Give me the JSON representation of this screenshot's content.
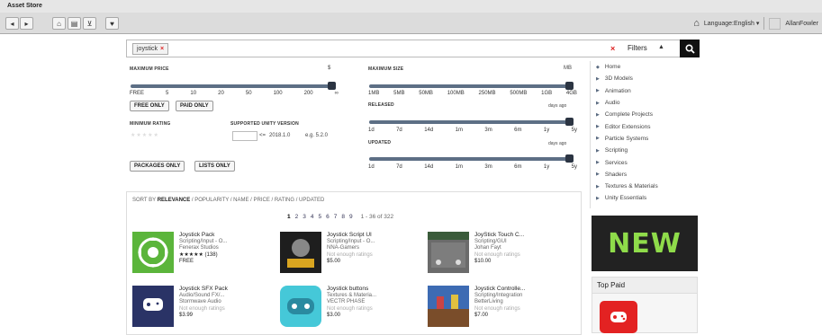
{
  "window": {
    "title": "Asset Store"
  },
  "toolbar": {
    "language_label": "Language:English",
    "user_name": "AllanFowler"
  },
  "search": {
    "tag": "joystick",
    "filters_label": "Filters"
  },
  "filters": {
    "max_price": {
      "label": "MAXIMUM PRICE",
      "unit": "$",
      "ticks": [
        "FREE",
        "5",
        "10",
        "20",
        "50",
        "100",
        "200",
        "∞"
      ]
    },
    "max_size": {
      "label": "MAXIMUM SIZE",
      "unit": "MB",
      "ticks": [
        "1MB",
        "5MB",
        "50MB",
        "100MB",
        "250MB",
        "500MB",
        "1GB",
        "4GB"
      ]
    },
    "free_only": "FREE ONLY",
    "paid_only": "PAID ONLY",
    "min_rating": "MINIMUM RATING",
    "supported_version": "SUPPORTED UNITY VERSION",
    "version_value": "2018.1.0",
    "version_op": "<=",
    "version_example": "e.g. 5.2.0",
    "released": {
      "label": "RELEASED",
      "unit": "days ago",
      "ticks": [
        "1d",
        "7d",
        "14d",
        "1m",
        "3m",
        "6m",
        "1y",
        "5y"
      ]
    },
    "updated": {
      "label": "UPDATED",
      "unit": "days ago",
      "ticks": [
        "1d",
        "7d",
        "14d",
        "1m",
        "3m",
        "6m",
        "1y",
        "5y"
      ]
    },
    "packages_only": "PACKAGES ONLY",
    "lists_only": "LISTS ONLY"
  },
  "categories": [
    "Home",
    "3D Models",
    "Animation",
    "Audio",
    "Complete Projects",
    "Editor Extensions",
    "Particle Systems",
    "Scripting",
    "Services",
    "Shaders",
    "Textures & Materials",
    "Unity Essentials"
  ],
  "banner": {
    "text": "NEW"
  },
  "top_paid": {
    "title": "Top Paid"
  },
  "results": {
    "sort": {
      "prefix": "SORT BY",
      "active": "RELEVANCE",
      "rest": "/ POPULARITY / NAME / PRICE / RATING / UPDATED"
    },
    "pages": [
      "1",
      "2",
      "3",
      "4",
      "5",
      "6",
      "7",
      "8",
      "9"
    ],
    "range": "1 - 36 of 322",
    "items": [
      {
        "title": "Joystick Pack",
        "category": "Scripting/Input - O...",
        "publisher": "Fenerax Studios",
        "rating": "★★★★★ (138)",
        "price": "FREE"
      },
      {
        "title": "Joystick Script UI",
        "category": "Scripting/Input - O...",
        "publisher": "NNA-Gamers",
        "rating": "Not enough ratings",
        "price": "$5.00"
      },
      {
        "title": "JoyStick Touch C...",
        "category": "Scripting/GUI",
        "publisher": "Johan Fayt",
        "rating": "Not enough ratings",
        "price": "$10.00"
      },
      {
        "title": "Joystick SFX Pack",
        "category": "Audio/Sound FX/...",
        "publisher": "Stormwave Audio",
        "rating": "Not enough ratings",
        "price": "$3.99"
      },
      {
        "title": "Joystick buttons",
        "category": "Textures & Materia...",
        "publisher": "VECTR PHASE",
        "rating": "Not enough ratings",
        "price": "$3.00"
      },
      {
        "title": "Joystick Controlle...",
        "category": "Scripting/Integration",
        "publisher": "BetterLiving",
        "rating": "Not enough ratings",
        "price": "$7.00"
      }
    ]
  },
  "colors": {
    "slider": "#5d6f85",
    "knob": "#2b3442",
    "banner_bg": "#222222",
    "banner_text": "#8fdc4a",
    "tag_x": "#dd2222"
  }
}
